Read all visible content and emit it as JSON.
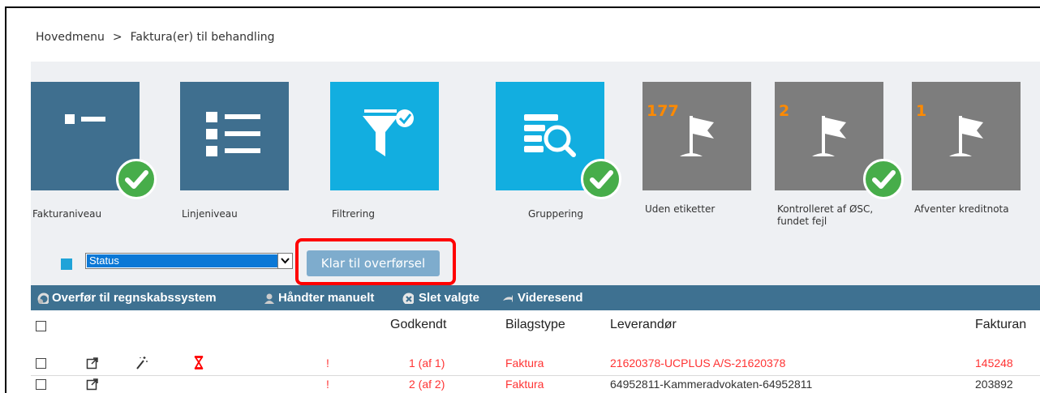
{
  "breadcrumb": {
    "home": "Hovedmenu",
    "separator": ">",
    "current": "Faktura(er) til behandling"
  },
  "tiles": [
    {
      "label": "Fakturaniveau",
      "icon": "invoice-level-icon",
      "checked": true
    },
    {
      "label": "Linjeniveau",
      "icon": "line-level-icon",
      "checked": false
    },
    {
      "label": "Filtrering",
      "icon": "filter-icon",
      "checked": false
    },
    {
      "label": "Gruppering",
      "icon": "grouping-icon",
      "checked": true
    },
    {
      "label": "Uden etiketter",
      "icon": "flag-icon",
      "count": "177",
      "checked": false
    },
    {
      "label": "Kontrolleret af ØSC, fundet fejl",
      "icon": "flag-icon",
      "count": "2",
      "checked": true
    },
    {
      "label": "Afventer kreditnota",
      "icon": "flag-icon",
      "count": "1",
      "checked": false
    }
  ],
  "status": {
    "select_value": "Status",
    "button_label": "Klar til overførsel"
  },
  "toolbar": {
    "transfer": "Overfør til regnskabssystem",
    "manual": "Håndter manuelt",
    "delete": "Slet valgte",
    "forward": "Videresend"
  },
  "table": {
    "headers": {
      "approved": "Godkendt",
      "doc_type": "Bilagstype",
      "supplier": "Leverandør",
      "invoice": "Fakturan"
    },
    "rows": [
      {
        "flag": "!",
        "approved": "1 (af 1)",
        "doc_type": "Faktura",
        "supplier": "21620378-UCPLUS A/S-21620378",
        "invoice": "145248"
      },
      {
        "flag": "!",
        "approved": "2 (af 2)",
        "doc_type": "Faktura",
        "supplier": "64952811-Kammeradvokaten-64952811",
        "invoice": "203892"
      }
    ]
  },
  "colors": {
    "tile_blue": "#3f6f8f",
    "tile_cyan": "#12aee0",
    "tile_gray": "#7d7d7d",
    "check_green": "#47ad4a",
    "highlight_red": "#ff0000",
    "toolbar_blue": "#3e7191",
    "count_orange": "#ff8a00"
  }
}
